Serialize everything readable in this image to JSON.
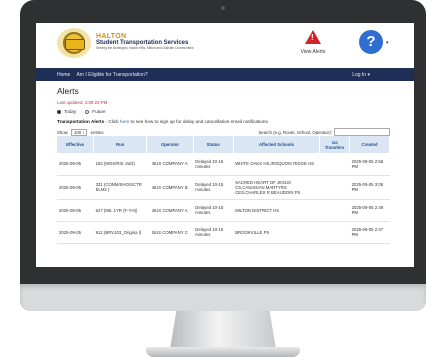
{
  "header": {
    "org_line1": "HALTON",
    "org_line2": "Student Transportation Services",
    "org_line3": "Serving the Burlington, Halton Hills, Milton and Oakville Communities",
    "view_alerts_label": "View Alerts",
    "help_glyph": "?"
  },
  "nav": {
    "home": "Home",
    "eligible": "Am I Eligible for Transportation?",
    "login": "Log In ▾"
  },
  "page": {
    "title": "Alerts",
    "last_updated": "Last updated: 3:09:23 PM",
    "radio_today": "Today",
    "radio_future": "Future",
    "desc_bold": "Transportation Alerts",
    "desc_pre": " - Click ",
    "desc_link": "here",
    "desc_post": " to see how to sign up for delay and cancellation email notifications",
    "show_label": "Show",
    "entries_value": "100 ↕",
    "entries_label": "entries",
    "search_label": "Search (e.g. Route, School, Operator):"
  },
  "table": {
    "headers": [
      "Effective",
      "Run",
      "Operator",
      "Status",
      "Affected Schools",
      "via Transfers",
      "Created"
    ],
    "rows": [
      {
        "effective": "2025-09-05",
        "run": "184 (MOS/RIS 1W2)",
        "operator": "BUS COMPANY A",
        "status": "Delayed 10-15 minutes",
        "schools": "WHITE OAKS HS,IROQUOIS RIDGE HS",
        "via": "",
        "created": "2025-09-05 2:58 PM"
      },
      {
        "effective": "2025-09-05",
        "run": "331 (CONM/SHOS/CTR ELM2 )",
        "operator": "BUS COMPANY B",
        "status": "Delayed 10-15 minutes",
        "schools": "SACRED HEART OF JESUS CS,CANADIAN MARTYRS CES,CHARLES R BEAUDOIN PS",
        "via": "",
        "created": "2025-09-05 3:06 PM"
      },
      {
        "effective": "2025-09-05",
        "run": "627 (MIL 1YR (F-YH))",
        "operator": "BUS COMPANY A",
        "status": "Delayed 10-15 minutes",
        "schools": "MILTON DISTRICT HS",
        "via": "",
        "created": "2025-09-05 2:49 PM"
      },
      {
        "effective": "2025-09-05",
        "run": "912 (BRV103_Origina l)",
        "operator": "BUS COMPANY C",
        "status": "Delayed 10-15 minutes",
        "schools": "BROOKVILLE PS",
        "via": "",
        "created": "2025-09-05 2:47 PM"
      }
    ]
  },
  "colors": {
    "navbar": "#1f2e57",
    "table_header_bg": "#dbe6f4",
    "alert_red": "#d3232a",
    "help_blue": "#2f6dd0"
  },
  "icons": [
    "warning-triangle-icon",
    "help-icon",
    "caret-down-icon",
    "sort-icon"
  ]
}
